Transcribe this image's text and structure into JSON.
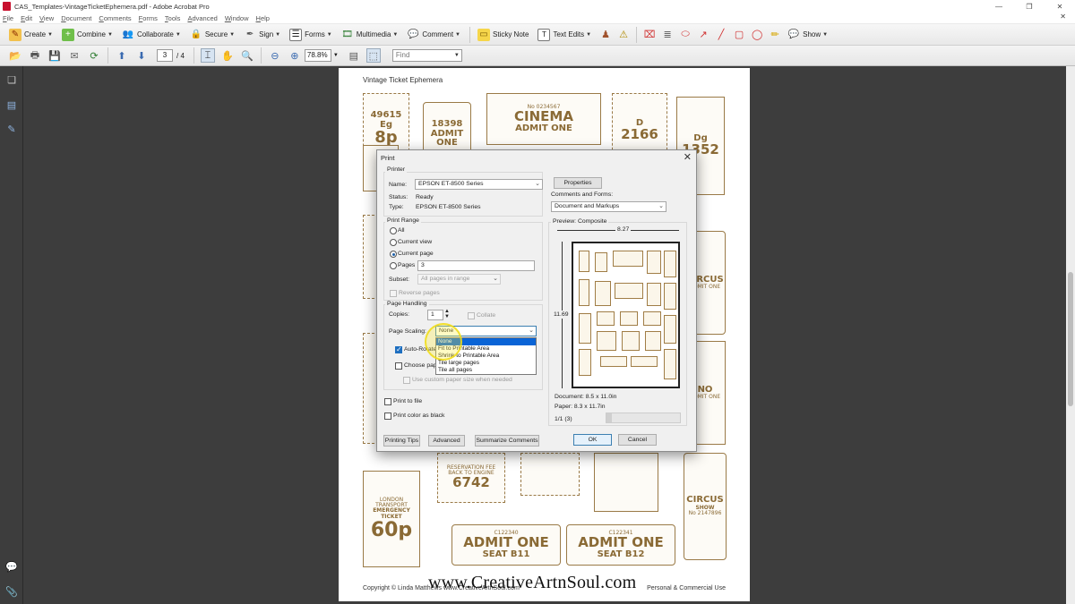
{
  "window": {
    "title": "CAS_Templates-VintageTicketEphemera.pdf - Adobe Acrobat Pro",
    "controls": [
      "—",
      "❐",
      "✕"
    ]
  },
  "menu": [
    "File",
    "Edit",
    "View",
    "Document",
    "Comments",
    "Forms",
    "Tools",
    "Advanced",
    "Window",
    "Help"
  ],
  "toolbar1": {
    "create": "Create",
    "combine": "Combine",
    "collaborate": "Collaborate",
    "secure": "Secure",
    "sign": "Sign",
    "forms": "Forms",
    "multimedia": "Multimedia",
    "comment": "Comment",
    "sticky_note": "Sticky Note",
    "text_edits": "Text Edits",
    "show": "Show"
  },
  "toolbar2": {
    "page_current": "3",
    "page_total": "/ 4",
    "zoom": "78.8%",
    "find_placeholder": "Find"
  },
  "document": {
    "title": "Vintage Ticket Ephemera",
    "footer_left": "Copyright © Linda Matthews www.CreativeArtnSoul.com",
    "footer_right": "Personal & Commercial Use",
    "watermark": "www.CreativeArtnSoul.com",
    "tickets": [
      {
        "big": "49615 Eg",
        "med": "8p",
        "sm": ""
      },
      {
        "big": "18398",
        "med": "ADMIT ONE",
        "sm": ""
      },
      {
        "big": "CINEMA",
        "med": "ADMIT ONE",
        "sm": "No 0234567"
      },
      {
        "big": "2166",
        "med": "D",
        "sm": ""
      },
      {
        "big": "1352",
        "med": "Dg",
        "sm": ""
      },
      {
        "big": "CIRCUS",
        "med": "ADMIT ONE",
        "sm": ""
      },
      {
        "big": "ADMIT ONE",
        "med": "NO",
        "sm": ""
      },
      {
        "big": "EMERGENCY TICKET",
        "med": "60p",
        "sm": "LONDON TRANSPORT"
      },
      {
        "big": "6742",
        "med": "BACK TO ENGINE",
        "sm": "RESERVATION FEE"
      },
      {
        "big": "ADMIT ONE",
        "med": "SEAT B11",
        "sm": "C122340"
      },
      {
        "big": "ADMIT ONE",
        "med": "SEAT B12",
        "sm": "C122341"
      },
      {
        "big": "CIRCUS",
        "med": "SHOW",
        "sm": "No 2147896"
      }
    ]
  },
  "print_dialog": {
    "title": "Print",
    "printer_group": "Printer",
    "name_label": "Name:",
    "printer_name": "EPSON ET-8500 Series",
    "properties_btn": "Properties",
    "status_label": "Status:",
    "status_value": "Ready",
    "type_label": "Type:",
    "type_value": "EPSON ET-8500 Series",
    "comments_forms_label": "Comments and Forms:",
    "comments_forms_value": "Document and Markups",
    "print_range_group": "Print Range",
    "range_all": "All",
    "range_current_view": "Current view",
    "range_current_page": "Current page",
    "range_pages": "Pages",
    "pages_value": "3",
    "subset_label": "Subset:",
    "subset_value": "All pages in range",
    "reverse_pages": "Reverse pages",
    "page_handling_group": "Page Handling",
    "copies_label": "Copies:",
    "copies_value": "1",
    "collate": "Collate",
    "page_scaling_label": "Page Scaling:",
    "page_scaling_value": "None",
    "scaling_options": [
      "None",
      "Fit to Printable Area",
      "Shrink to Printable Area",
      "Tile large pages",
      "Tile all pages"
    ],
    "auto_rotate": "Auto-Rotate",
    "choose_paper": "Choose pape",
    "custom_paper": "Use custom paper size when needed",
    "print_to_file": "Print to file",
    "print_color_black": "Print color as black",
    "preview_label": "Preview: Composite",
    "preview_width": "8.27",
    "preview_height": "11.69",
    "document_size": "Document: 8.5 x 11.0in",
    "paper_size": "Paper: 8.3 x 11.7in",
    "page_indicator": "1/1 (3)",
    "printing_tips_btn": "Printing Tips",
    "advanced_btn": "Advanced",
    "summarize_btn": "Summarize Comments",
    "ok_btn": "OK",
    "cancel_btn": "Cancel"
  },
  "colors": {
    "ticket_ink": "#8a6a35",
    "dialog_bg": "#f0f0f0",
    "selection": "#0a64d6",
    "cursor_highlight": "#f0dc14"
  }
}
